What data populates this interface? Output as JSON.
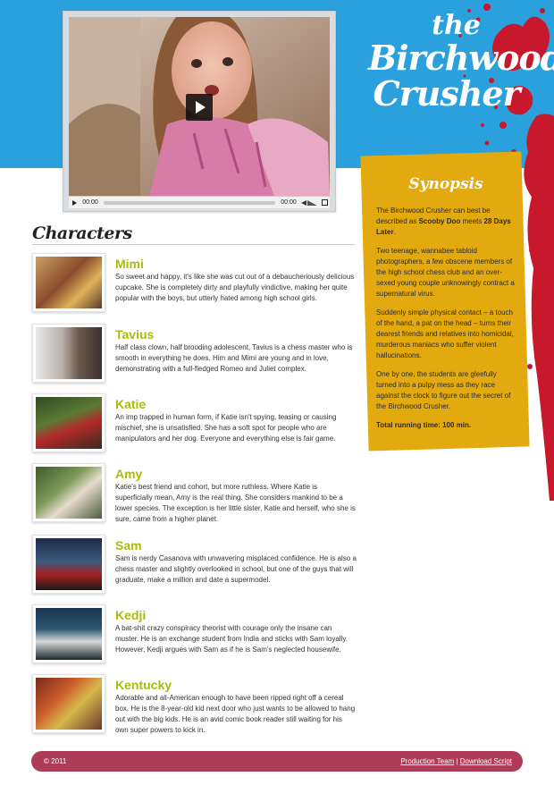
{
  "logo": {
    "line1": "the",
    "line2": "Birchwood",
    "line3": "Crusher"
  },
  "video": {
    "time_current": "00:00",
    "time_total": "00:00"
  },
  "synopsis": {
    "title": "Synopsis",
    "p1_pre": "The Birchwood Crusher can best be described as ",
    "p1_bold1": "Scooby Doo",
    "p1_mid": " meets ",
    "p1_bold2": "28 Days Later",
    "p1_end": ".",
    "p2": "Two teenage, wannabee tabloid photographers, a few obscene members of the high school chess club and an over-sexed young couple unknowingly contract a supernatural virus.",
    "p3": "Suddenly simple physical contact – a touch of the hand, a pat on the head – turns their dearest friends and relatives into homicidal, murderous maniacs who suffer violent hallucinations.",
    "p4": "One by one, the students are gleefully turned into a pulpy mess as they race against the clock to figure out the secret of the Birchwood Crusher.",
    "runtime": "Total running time: 100 min."
  },
  "characters": {
    "heading": "Characters",
    "items": [
      {
        "name": "Mimi",
        "desc": "So sweet and happy, it's like she was cut out of a debaucheriously delicious cupcake. She is completely dirty and playfully vindictive, making her quite popular with the boys, but utterly hated among high school girls."
      },
      {
        "name": "Tavius",
        "desc": "Half class clown, half brooding adolescent, Tavius is a chess master who is smooth in everything he does. Him and Mimi are young and in love, demonstrating with a full-fledged Romeo and Juliet complex."
      },
      {
        "name": "Katie",
        "desc": "An imp trapped in human form, if Katie isn't spying, teasing or causing mischief, she is unsatisfied. She has a soft spot for people who are manipulators and her dog. Everyone and everything else is fair game."
      },
      {
        "name": "Amy",
        "desc": "Katie's best friend and cohort, but more ruthless. Where Katie is superficially mean, Amy is the real thing. She considers mankind to be a lower species. The exception is her little sister, Katie and herself, who she is sure, came from a higher planet."
      },
      {
        "name": "Sam",
        "desc": "Sam is nerdy Casanova with unwavering misplaced confidence. He is also a chess master and slightly overlooked in school, but one of the guys that will graduate, make a million and date a supermodel."
      },
      {
        "name": "Kedji",
        "desc": "A bat-shit crazy conspiracy theorist with courage only the insane can muster. He is an exchange student from India and sticks with Sam loyally. However, Kedji argues with Sam as if he is Sam's neglected housewife."
      },
      {
        "name": "Kentucky",
        "desc": "Adorable and all-American enough to have been ripped right off a cereal box. He is the 8-year-old kid next door who just wants to be allowed to hang out with the big kids. He is an avid comic book reader still waiting for his own super powers to kick in."
      }
    ]
  },
  "footer": {
    "copyright": "© 2011",
    "link_team": "Production Team",
    "separator": " | ",
    "link_script": "Download Script"
  },
  "colors": {
    "header_blue": "#2aa0dc",
    "synopsis_yellow": "#e3aa10",
    "name_green": "#a9bb0e",
    "footer_maroon": "#ae3c58",
    "blood_red": "#c8182c"
  }
}
